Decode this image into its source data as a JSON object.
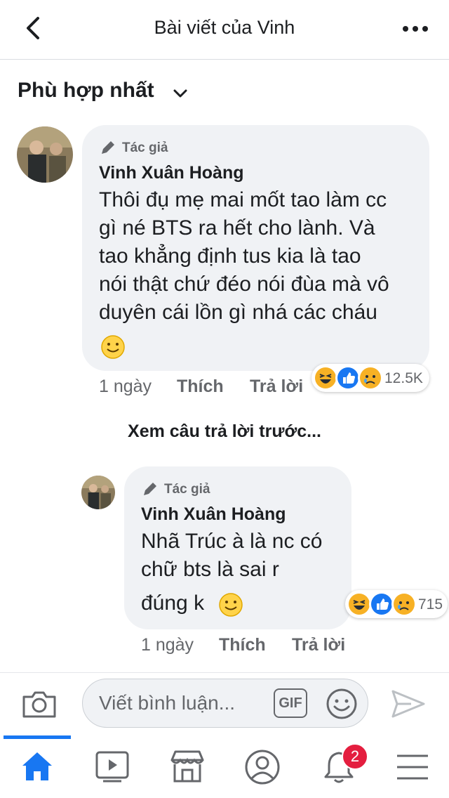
{
  "header": {
    "title": "Bài viết của Vinh"
  },
  "sort": {
    "label": "Phù hợp nhất"
  },
  "comments": [
    {
      "badge": "Tác giả",
      "author": "Vinh Xuân Hoàng",
      "lines": [
        "Thôi đụ mẹ mai mốt tao làm cc",
        "gì né BTS ra hết  cho lành.  Và",
        "tao khẳng định tus kia là tao",
        "nói thật chứ đéo nói đùa mà vô",
        "duyên cái lồn gì nhá các cháu"
      ],
      "time": "1 ngày",
      "like": "Thích",
      "reply": "Trả lời",
      "reaction_count": "12.5K"
    },
    {
      "badge": "Tác giả",
      "author": "Vinh Xuân Hoàng",
      "lines": [
        "Nhã Trúc à là nc có",
        "chữ bts là sai r",
        "đúng k"
      ],
      "time": "1 ngày",
      "like": "Thích",
      "reply": "Trả lời",
      "reaction_count": "715"
    }
  ],
  "view_previous": "Xem câu trả lời trước...",
  "composer": {
    "placeholder": "Viết bình luận...",
    "gif": "GIF"
  },
  "tabs": [
    {
      "name": "home",
      "icon": "home-icon"
    },
    {
      "name": "watch",
      "icon": "video-icon"
    },
    {
      "name": "marketplace",
      "icon": "shop-icon"
    },
    {
      "name": "profile",
      "icon": "profile-icon"
    },
    {
      "name": "notifications",
      "icon": "bell-icon",
      "badge": "2"
    },
    {
      "name": "menu",
      "icon": "hamburger-icon"
    }
  ],
  "colors": {
    "accent": "#1877f2",
    "badge": "#e41e3f",
    "bubble": "#f0f2f5"
  }
}
